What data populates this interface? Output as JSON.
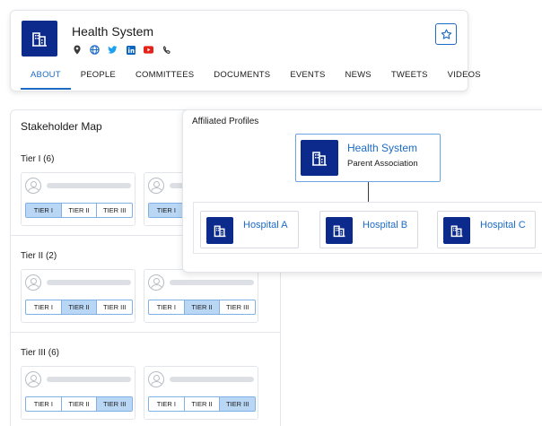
{
  "header": {
    "org_name": "Health System",
    "social_icons": [
      {
        "name": "location-icon",
        "color": "#3a3a3a"
      },
      {
        "name": "globe-icon",
        "color": "#1c6bc7"
      },
      {
        "name": "twitter-icon",
        "color": "#1da1f2"
      },
      {
        "name": "linkedin-icon",
        "color": "#0a66c2"
      },
      {
        "name": "youtube-icon",
        "color": "#e62117"
      },
      {
        "name": "phone-icon",
        "color": "#3a3a3a"
      }
    ],
    "tabs": [
      {
        "label": "ABOUT",
        "active": true
      },
      {
        "label": "PEOPLE",
        "active": false
      },
      {
        "label": "COMMITTEES",
        "active": false
      },
      {
        "label": "DOCUMENTS",
        "active": false
      },
      {
        "label": "EVENTS",
        "active": false
      },
      {
        "label": "NEWS",
        "active": false
      },
      {
        "label": "TWEETS",
        "active": false
      },
      {
        "label": "VIDEOS",
        "active": false
      }
    ]
  },
  "stakeholder_map": {
    "title": "Stakeholder Map",
    "tier_labels": [
      "TIER I",
      "TIER II",
      "TIER III"
    ],
    "tiers": [
      {
        "heading": "Tier I (6)",
        "selected_index": 0
      },
      {
        "heading": "Tier II (2)",
        "selected_index": 1
      },
      {
        "heading": "Tier III (6)",
        "selected_index": 2
      }
    ]
  },
  "affiliated_profiles": {
    "title": "Affiliated Profiles",
    "parent": {
      "name": "Health System",
      "subtitle": "Parent Association"
    },
    "children": [
      {
        "name": "Hospital A"
      },
      {
        "name": "Hospital B"
      },
      {
        "name": "Hospital C"
      }
    ]
  },
  "colors": {
    "brand_navy": "#0b2a8c",
    "accent_blue": "#1c6bc7",
    "selected_tier_bg": "#b9d7f5"
  }
}
